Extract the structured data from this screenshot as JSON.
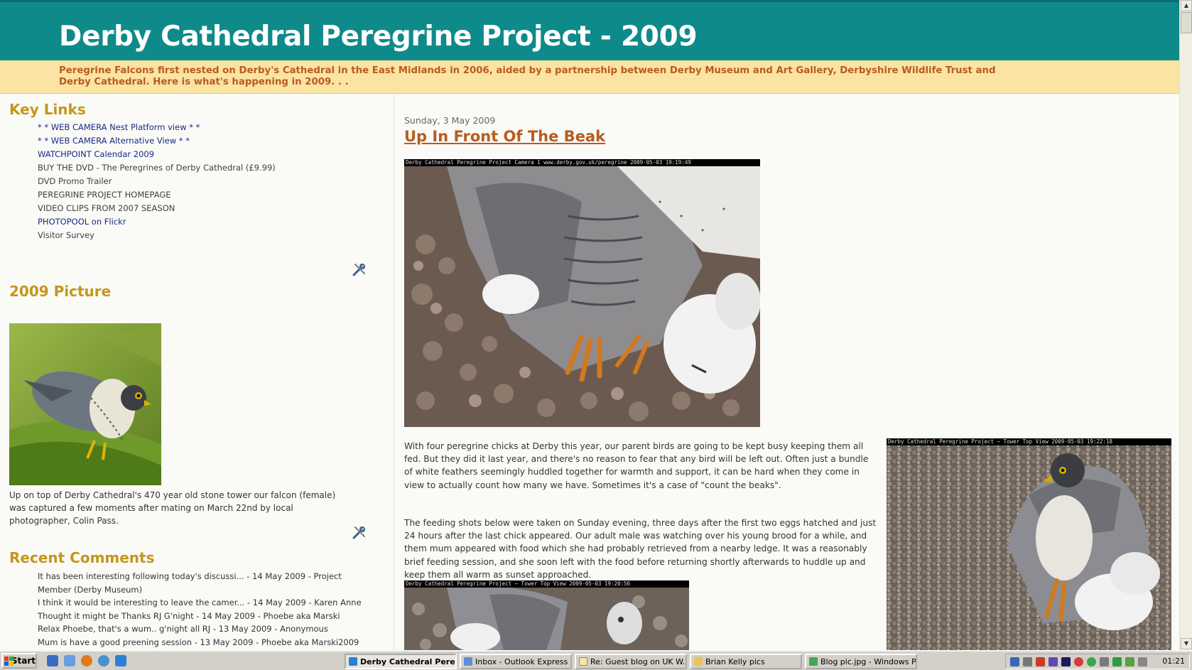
{
  "blog": {
    "title": "Derby Cathedral Peregrine Project - 2009",
    "description": "Peregrine Falcons first nested on Derby's Cathedral in the East Midlands in 2006, aided by a partnership between Derby Museum and Art Gallery, Derbyshire Wildlife Trust and Derby Cathedral. Here is what's happening in 2009. . ."
  },
  "sidebar": {
    "key_links_heading": "Key Links",
    "key_links": [
      {
        "label": "* * WEB CAMERA Nest Platform view * *"
      },
      {
        "label": "* * WEB CAMERA Alternative View * *"
      },
      {
        "label": "WATCHPOINT Calendar 2009"
      },
      {
        "label": "BUY THE DVD - The Peregrines of Derby Cathedral (£9.99)"
      },
      {
        "label": "DVD Promo Trailer"
      },
      {
        "label": "PEREGRINE PROJECT HOMEPAGE"
      },
      {
        "label": "VIDEO CLIPS FROM 2007 SEASON"
      },
      {
        "label": "PHOTOPOOL on Flickr"
      },
      {
        "label": "Visitor Survey"
      }
    ],
    "picture_heading": "2009 Picture",
    "picture_caption": "Up on top of Derby Cathedral's 470 year old stone tower our falcon (female) was captured a few moments after mating on March 22nd by local photographer, Colin Pass.",
    "comments_heading": "Recent Comments",
    "comments": [
      "It has been interesting following today's discussi... - 14 May 2009 - Project Member (Derby Museum)",
      "I think it would be interesting to leave the camer... - 14 May 2009 - Karen Anne",
      "Thought it might be     Thanks RJ     G'night - 14 May 2009 - Phoebe aka Marski",
      "Relax Phoebe, that's a wum..  g'night all  RJ - 13 May 2009 - Anonymous",
      "Mum is have a good preening session - 13 May 2009 - Phoebe aka Marski2009"
    ]
  },
  "post": {
    "date": "Sunday, 3 May 2009",
    "title": "Up In Front Of The Beak",
    "image1_caption": "Derby Cathedral Peregrine Project     Camera 1     www.derby.gov.uk/peregrine     2009-05-03 19:19:49",
    "image2_caption": "Derby Cathedral Peregrine Project  ~  Tower Top View 2009-05-03 19:22:18",
    "image3_caption": "Derby Cathedral Peregrine Project  ~  Tower Top View 2009-05-03 19:20:56",
    "paragraph1": "With four peregrine chicks at Derby this year, our parent birds are going to be kept busy keeping them all fed. But they did it last year, and there's no reason to fear that any bird will be left out. Often just a bundle of white feathers seemingly huddled together for warmth and support, it can be hard when they come in view to actually count how many we have. Sometimes it's a case of \"count the beaks\".",
    "paragraph2": "The feeding shots below were taken on Sunday evening, three days after the first two eggs hatched and just 24 hours after the last chick appeared. Our adult male was watching over his young brood for a while, and them mum appeared with food which she had probably retrieved from a nearby ledge. It was a reasonably brief feeding session, and she soon left with the food before returning shortly afterwards to huddle up and keep them all warm as sunset approached."
  },
  "taskbar": {
    "start_label": "Start",
    "tasks": [
      {
        "label": "Derby Cathedral Pere...",
        "active": true
      },
      {
        "label": "Inbox - Outlook Express ...",
        "active": false
      },
      {
        "label": "Re: Guest blog on UK W...",
        "active": false
      },
      {
        "label": "Brian Kelly pics",
        "active": false
      },
      {
        "label": "Blog pic.jpg - Windows Pi...",
        "active": false
      }
    ],
    "clock": "01:21"
  },
  "colors": {
    "header_bg": "#0f8a8a",
    "description_bg": "#fbe3a3",
    "heading": "#c4961c",
    "post_title": "#b85c1f",
    "link": "#1a2a88"
  }
}
